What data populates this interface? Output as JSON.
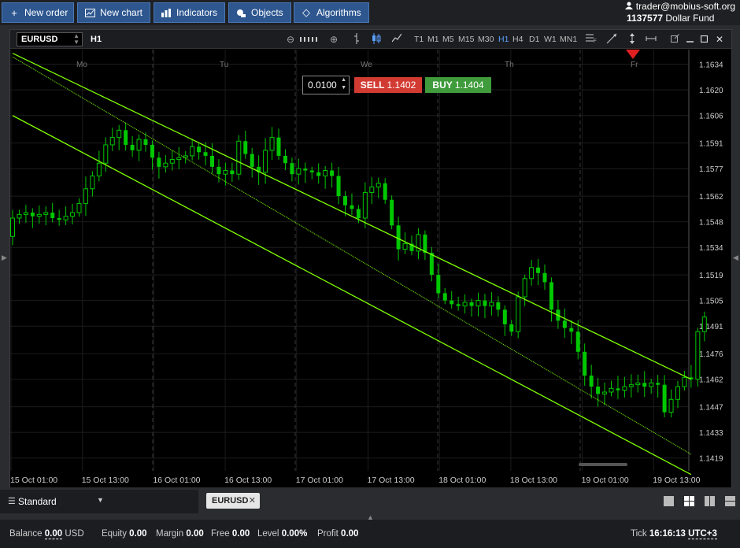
{
  "toolbar": {
    "new_order": "New order",
    "new_chart": "New chart",
    "indicators": "Indicators",
    "objects": "Objects",
    "algorithms": "Algorithms"
  },
  "account": {
    "user": "trader@mobius-soft.org",
    "number": "1137577",
    "name": "Dollar Fund"
  },
  "chart": {
    "symbol": "EURUSD",
    "timeframe": "H1",
    "timeframes": [
      "T1",
      "M1",
      "M5",
      "M15",
      "M30",
      "H1",
      "H4",
      "D1",
      "W1",
      "MN1"
    ],
    "active_timeframe": "H1",
    "lot": "0.0100",
    "sell_label": "SELL",
    "sell_price": "1.1402",
    "buy_label": "BUY",
    "buy_price": "1.1404",
    "days": [
      "Mo",
      "Tu",
      "We",
      "Th",
      "Fr"
    ]
  },
  "chart_data": {
    "type": "candlestick",
    "price_ticks": [
      "1.1634",
      "1.1620",
      "1.1606",
      "1.1591",
      "1.1577",
      "1.1562",
      "1.1548",
      "1.1534",
      "1.1519",
      "1.1505",
      "1.1491",
      "1.1476",
      "1.1462",
      "1.1447",
      "1.1433",
      "1.1419"
    ],
    "time_ticks": [
      "15 Oct 01:00",
      "15 Oct 13:00",
      "16 Oct 01:00",
      "16 Oct 13:00",
      "17 Oct 01:00",
      "17 Oct 13:00",
      "18 Oct 01:00",
      "18 Oct 13:00",
      "19 Oct 01:00",
      "19 Oct 13:00"
    ],
    "ylim": [
      1.1412,
      1.1642
    ],
    "grid": true,
    "channel_upper": [
      [
        0,
        1.164
      ],
      [
        102,
        1.1462
      ]
    ],
    "channel_mid": [
      [
        0,
        1.1638
      ],
      [
        102,
        1.1421
      ]
    ],
    "channel_lower": [
      [
        0,
        1.1606
      ],
      [
        102,
        1.141
      ]
    ],
    "closes": [
      1.155,
      1.1552,
      1.1553,
      1.1551,
      1.1552,
      1.1553,
      1.155,
      1.1549,
      1.1551,
      1.1553,
      1.1558,
      1.1566,
      1.1573,
      1.158,
      1.159,
      1.1594,
      1.1598,
      1.159,
      1.1587,
      1.1593,
      1.159,
      1.1583,
      1.1578,
      1.158,
      1.1582,
      1.1583,
      1.1584,
      1.1589,
      1.1586,
      1.1584,
      1.1578,
      1.1574,
      1.1576,
      1.1574,
      1.1592,
      1.1585,
      1.1578,
      1.1575,
      1.1587,
      1.1594,
      1.1584,
      1.158,
      1.1574,
      1.1577,
      1.1576,
      1.1575,
      1.1573,
      1.1576,
      1.1573,
      1.1562,
      1.1557,
      1.1555,
      1.155,
      1.1564,
      1.1567,
      1.1569,
      1.156,
      1.1546,
      1.1533,
      1.1536,
      1.1532,
      1.1541,
      1.1531,
      1.1519,
      1.1509,
      1.1505,
      1.1503,
      1.1502,
      1.1504,
      1.1502,
      1.1505,
      1.1502,
      1.1504,
      1.15,
      1.1492,
      1.1488,
      1.1507,
      1.1517,
      1.1523,
      1.152,
      1.1515,
      1.15,
      1.1494,
      1.149,
      1.1488,
      1.1477,
      1.1464,
      1.1458,
      1.1454,
      1.1455,
      1.1457,
      1.1456,
      1.1458,
      1.1459,
      1.146,
      1.1458,
      1.146,
      1.1459,
      1.1444,
      1.1451,
      1.1458,
      1.1463,
      1.1462,
      1.1488,
      1.1496
    ]
  },
  "tabs": {
    "workspace": "Standard",
    "chart_tab": "EURUSD"
  },
  "status": {
    "balance_label": "Balance",
    "balance": "0.00",
    "currency": "USD",
    "equity_label": "Equity",
    "equity": "0.00",
    "margin_label": "Margin",
    "margin": "0.00",
    "free_label": "Free",
    "free": "0.00",
    "level_label": "Level",
    "level": "0.00%",
    "profit_label": "Profit",
    "profit": "0.00",
    "tick_label": "Tick",
    "time": "16:16:13",
    "tz": "UTC+3"
  },
  "colors": {
    "candle": "#00c800",
    "channel": "#7fff00",
    "sell": "#d23b32",
    "buy": "#3f9b3b",
    "active_tf": "#5aa0ff"
  }
}
